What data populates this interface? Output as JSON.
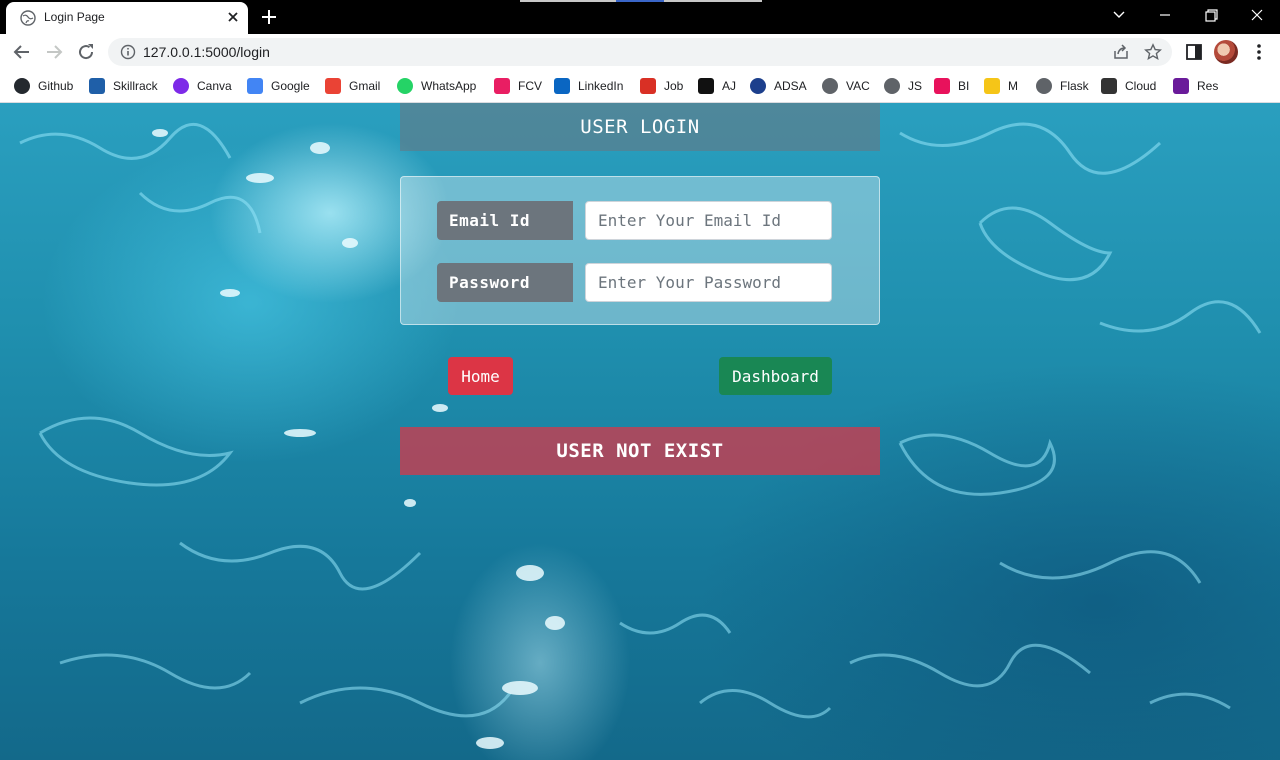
{
  "browser": {
    "tab_title": "Login Page",
    "url": "127.0.0.1:5000/login",
    "bookmarks": [
      {
        "label": "Github",
        "icon": "github-icon",
        "color": "#24292f"
      },
      {
        "label": "Skillrack",
        "icon": "skillrack-icon",
        "color": "#1f5fa8"
      },
      {
        "label": "Canva",
        "icon": "canva-icon",
        "color": "#7d2ae8"
      },
      {
        "label": "Google",
        "icon": "google-icon",
        "color": "#4285f4"
      },
      {
        "label": "Gmail",
        "icon": "gmail-icon",
        "color": "#ea4335"
      },
      {
        "label": "WhatsApp",
        "icon": "whatsapp-icon",
        "color": "#25d366"
      },
      {
        "label": "FCV",
        "icon": "fcv-icon",
        "color": "#e91e63"
      },
      {
        "label": "LinkedIn",
        "icon": "linkedin-icon",
        "color": "#0a66c2"
      },
      {
        "label": "Job",
        "icon": "job-icon",
        "color": "#d93025"
      },
      {
        "label": "AJ",
        "icon": "amazon-icon",
        "color": "#111111"
      },
      {
        "label": "ADSA",
        "icon": "ad-icon",
        "color": "#1c3f8c"
      },
      {
        "label": "VAC",
        "icon": "globe-icon",
        "color": "#5f6368"
      },
      {
        "label": "JS",
        "icon": "globe-icon",
        "color": "#5f6368"
      },
      {
        "label": "BI",
        "icon": "bi-icon",
        "color": "#e8125c"
      },
      {
        "label": "M",
        "icon": "m-icon",
        "color": "#f5c518"
      },
      {
        "label": "Flask",
        "icon": "globe-icon",
        "color": "#5f6368"
      },
      {
        "label": "Cloud",
        "icon": "cloud-icon",
        "color": "#333333"
      },
      {
        "label": "Res",
        "icon": "res-icon",
        "color": "#6a1b9a"
      }
    ]
  },
  "login": {
    "title": "USER LOGIN",
    "email_label": "Email Id",
    "email_placeholder": "Enter Your Email Id",
    "email_value": "",
    "password_label": "Password",
    "password_placeholder": "Enter Your Password",
    "password_value": ""
  },
  "buttons": {
    "home": "Home",
    "dashboard": "Dashboard"
  },
  "alert": {
    "message": "USER NOT EXIST"
  },
  "colors": {
    "label_bg": "#6c757d",
    "home_btn": "#dc3545",
    "dashboard_btn": "#198754",
    "alert_bg": "#dc3545"
  }
}
